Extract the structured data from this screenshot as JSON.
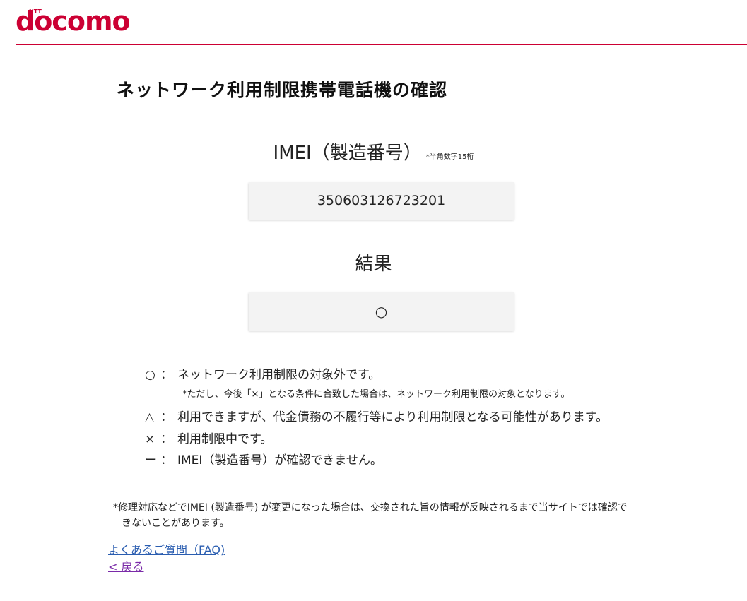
{
  "header": {
    "brand_prefix": "NTT",
    "brand": "docomo",
    "brand_color": "#cc0033"
  },
  "page": {
    "title": "ネットワーク利用制限携帯電話機の確認"
  },
  "imei": {
    "label": "IMEI（製造番号）",
    "note": "*半角数字15桁",
    "value": "350603126723201"
  },
  "result": {
    "label": "結果",
    "value": "○"
  },
  "legend": [
    {
      "symbol": "○",
      "colon": "：",
      "text": "ネットワーク利用制限の対象外です。"
    },
    {
      "symbol": "△",
      "colon": "：",
      "text": "利用できますが、代金債務の不履行等により利用制限となる可能性があります。"
    },
    {
      "symbol": "×",
      "colon": "：",
      "text": "利用制限中です。"
    },
    {
      "symbol": "ー",
      "colon": "：",
      "text": "IMEI（製造番号）が確認できません。"
    }
  ],
  "legend_note": "*ただし、今後「×」となる条件に合致した場合は、ネットワーク利用制限の対象となります。",
  "footnote": {
    "line1": "*修理対応などでIMEI (製造番号) が変更になった場合は、交換された旨の情報が反映されるまで当サイトでは確認で",
    "line2": "きないことがあります。"
  },
  "links": {
    "faq": "よくあるご質問（FAQ)",
    "back": "< 戻る"
  }
}
